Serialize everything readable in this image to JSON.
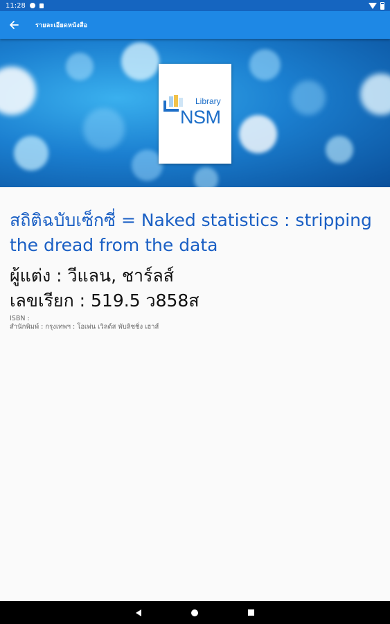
{
  "status_bar": {
    "time": "11:28",
    "icons": [
      "notification-dot-icon",
      "lock-icon",
      "wifi-icon",
      "battery-icon"
    ]
  },
  "app_bar": {
    "title": "รายละเอียดหนังสือ",
    "back_icon": "arrow-left-icon",
    "color": "#1e88e5"
  },
  "cover": {
    "logo_library": "Library",
    "logo_nsm": "NSM",
    "logo_color": "#1e6fc8"
  },
  "book": {
    "title": "สถิติฉบับเซ็กซี่ = Naked statistics : stripping the dread from the data",
    "author": "ผู้แต่ง : วีแลน, ชาร์ลส์",
    "call_number": "เลขเรียก : 519.5 ว858ส",
    "isbn": "ISBN :",
    "publisher": "สำนักพิมพ์ : กรุงเทพฯ : โอเพ่น เวิลด์ส พับลิชชิ่ง เฮาส์",
    "title_color": "#1a5fc4"
  },
  "nav_bar": {
    "icons": [
      "nav-back-icon",
      "nav-home-icon",
      "nav-recents-icon"
    ]
  }
}
